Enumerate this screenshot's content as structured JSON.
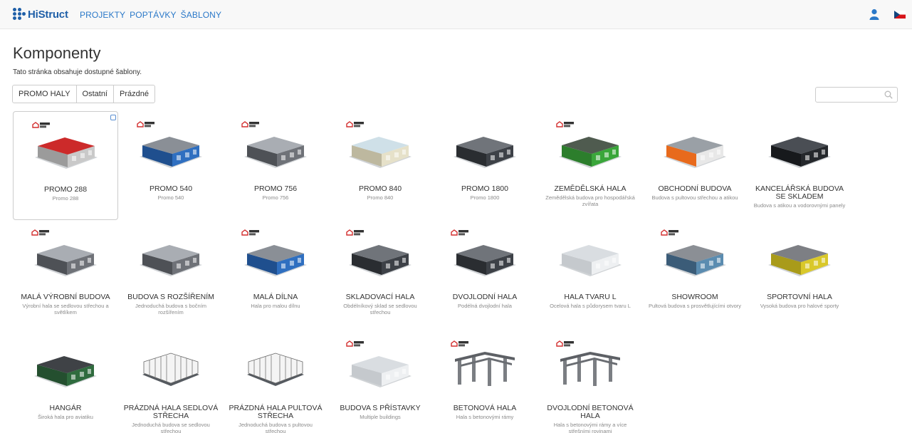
{
  "brand": {
    "name": "HiStruct",
    "accent": "#1f5fa8",
    "link": "#2a78c8"
  },
  "nav": {
    "items": [
      "PROJEKTY",
      "POPTÁVKY",
      "ŠABLONY"
    ],
    "user_icon": "user-icon",
    "language_flag": "cz-flag-icon"
  },
  "page": {
    "title": "Komponenty",
    "subtitle": "Tato stránka obsahuje dostupné šablony."
  },
  "filters": [
    "PROMO HALY",
    "Ostatní",
    "Prázdné"
  ],
  "search": {
    "placeholder": "",
    "icon": "search-icon"
  },
  "templates": [
    {
      "title": "PROMO 288",
      "desc": "Promo 288",
      "promo": true,
      "selected": true,
      "style": "red"
    },
    {
      "title": "PROMO 540",
      "desc": "Promo 540",
      "promo": true,
      "style": "blue"
    },
    {
      "title": "PROMO 756",
      "desc": "Promo 756",
      "promo": true,
      "style": "grey"
    },
    {
      "title": "PROMO 840",
      "desc": "Promo 840",
      "promo": true,
      "style": "cream"
    },
    {
      "title": "PROMO 1800",
      "desc": "Promo 1800",
      "promo": false,
      "style": "dark"
    },
    {
      "title": "ZEMĚDĚLSKÁ HALA",
      "desc": "Zemědělská budova pro hospodářská zvířata",
      "promo": true,
      "style": "green"
    },
    {
      "title": "OBCHODNÍ BUDOVA",
      "desc": "Budova s pultovou střechou a atikou",
      "promo": false,
      "style": "orange"
    },
    {
      "title": "KANCELÁŘSKÁ BUDOVA SE SKLADEM",
      "desc": "Budova s atikou a vodorovnými panely",
      "promo": false,
      "style": "black"
    },
    {
      "title": "MALÁ VÝROBNÍ BUDOVA",
      "desc": "Výrobní hala se sedlovou střechou a světlíkem",
      "promo": true,
      "style": "grey"
    },
    {
      "title": "BUDOVA S ROZŠÍŘENÍM",
      "desc": "Jednoduchá budova s bočním rozšířením",
      "promo": false,
      "style": "grey"
    },
    {
      "title": "MALÁ DÍLNA",
      "desc": "Hala pro malou dílnu",
      "promo": true,
      "style": "blue"
    },
    {
      "title": "SKLADOVACÍ HALA",
      "desc": "Obdélníkový sklad se sedlovou střechou",
      "promo": true,
      "style": "dark"
    },
    {
      "title": "DVOJLODNÍ HALA",
      "desc": "Podélná dvojlodní hala",
      "promo": true,
      "style": "dark"
    },
    {
      "title": "HALA TVARU L",
      "desc": "Ocelová hala s půdorysem tvaru L",
      "promo": false,
      "style": "white"
    },
    {
      "title": "SHOWROOM",
      "desc": "Pultová budova s prosvětlujícími otvory",
      "promo": true,
      "style": "glass"
    },
    {
      "title": "SPORTOVNÍ HALA",
      "desc": "Vysoká budova pro halové sporty",
      "promo": false,
      "style": "yellow"
    },
    {
      "title": "HANGÁR",
      "desc": "Široká hala pro aviatiku",
      "promo": false,
      "style": "hangar"
    },
    {
      "title": "PRÁZDNÁ HALA SEDLOVÁ STŘECHA",
      "desc": "Jednoduchá budova se sedlovou střechou",
      "promo": false,
      "style": "frame"
    },
    {
      "title": "PRÁZDNÁ HALA PULTOVÁ STŘECHA",
      "desc": "Jednoduchá budova s pultovou střechou",
      "promo": false,
      "style": "frame"
    },
    {
      "title": "BUDOVA S PŘÍSTAVKY",
      "desc": "Multiple buildings",
      "promo": true,
      "style": "white"
    },
    {
      "title": "BETONOVÁ HALA",
      "desc": "Hala s betonovými rámy",
      "promo": true,
      "style": "concrete"
    },
    {
      "title": "DVOJLODNÍ BETONOVÁ HALA",
      "desc": "Hala s betonovými rámy a více střešními rovinami",
      "promo": true,
      "style": "concrete"
    }
  ]
}
